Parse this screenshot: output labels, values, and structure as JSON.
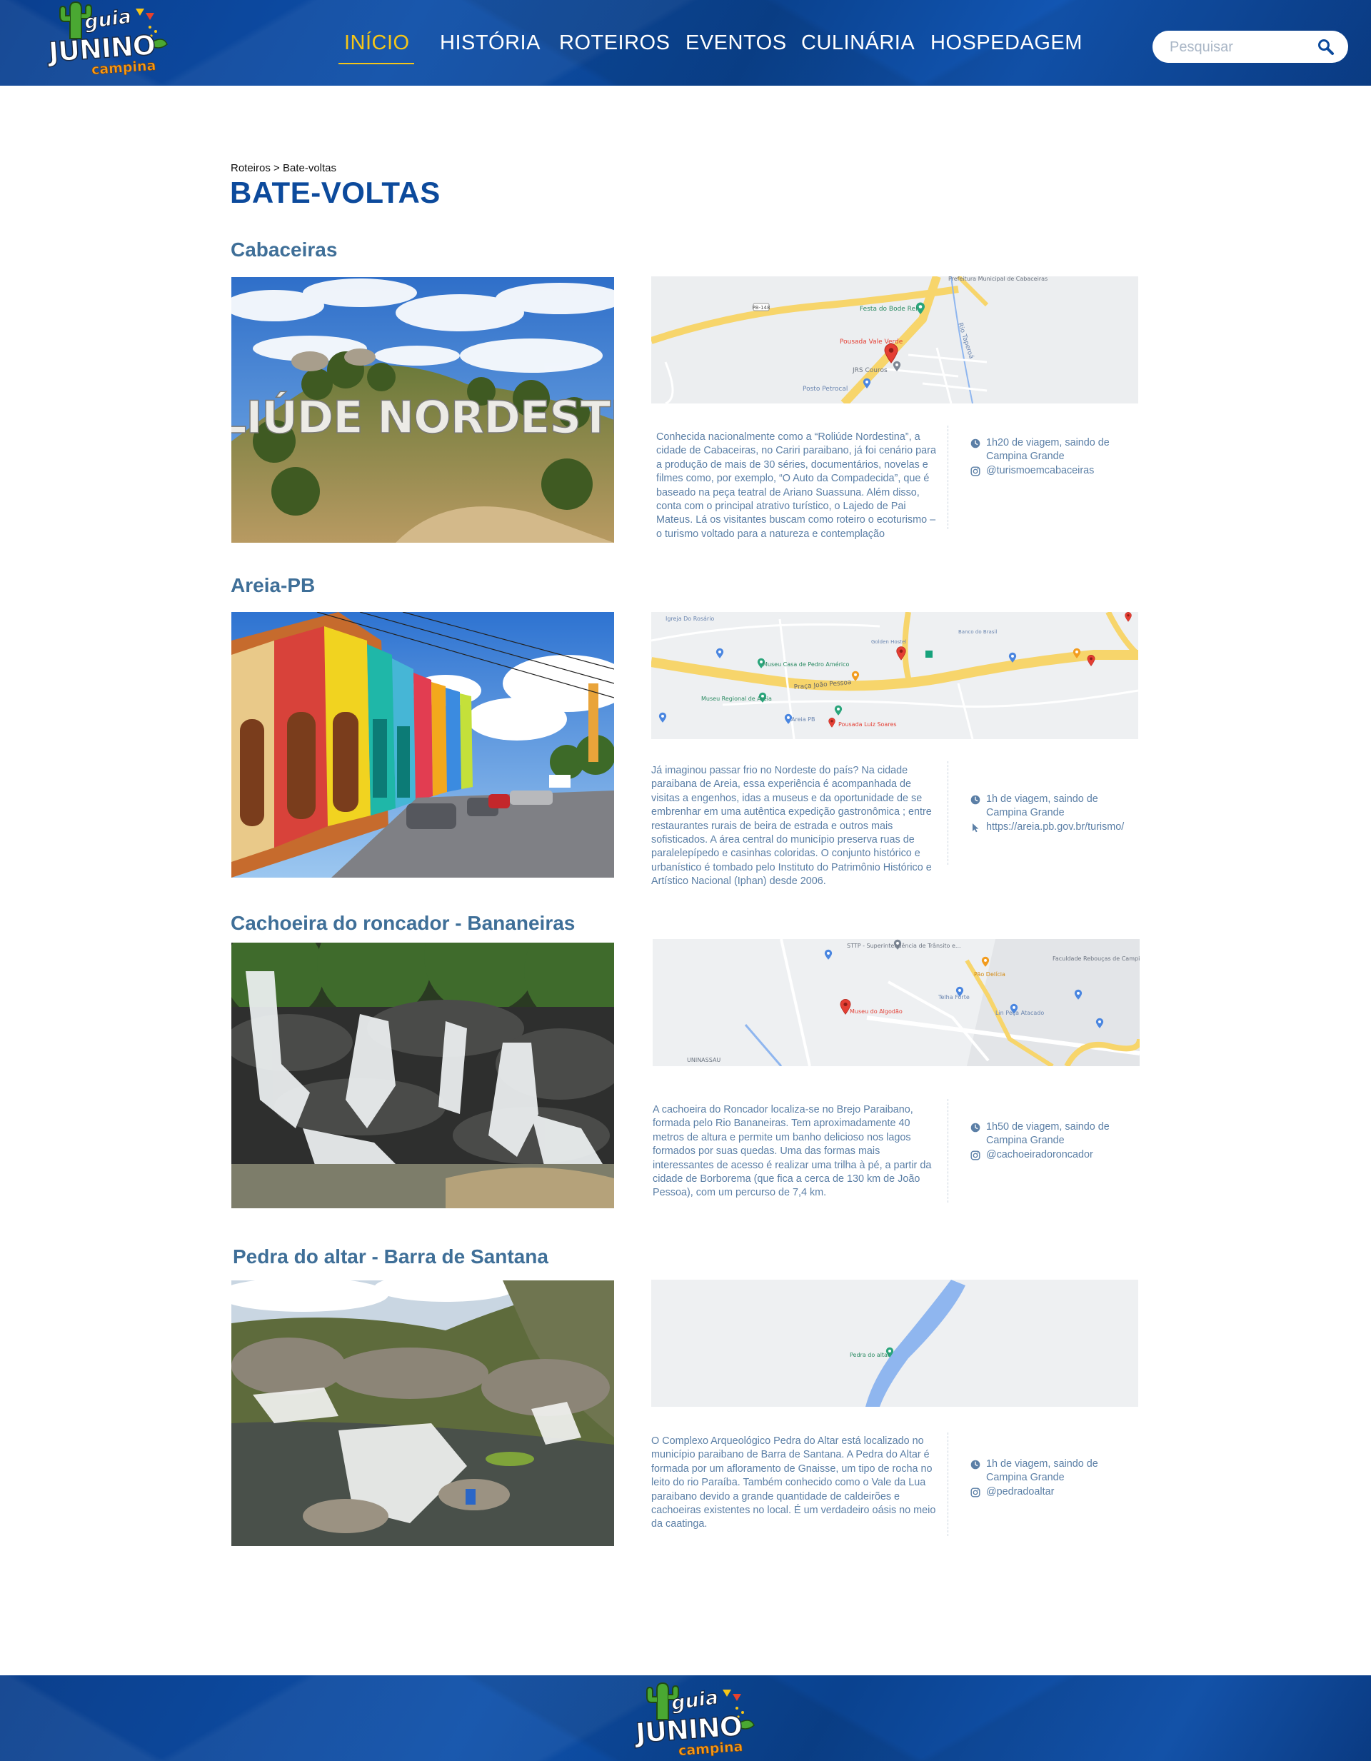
{
  "header": {
    "logo": {
      "line1": "guia",
      "line2": "JUNINO",
      "line3": "campina"
    },
    "nav": [
      {
        "label": "INÍCIO",
        "active": true
      },
      {
        "label": "HISTÓRIA",
        "active": false
      },
      {
        "label": "ROTEIROS",
        "active": false
      },
      {
        "label": "EVENTOS",
        "active": false
      },
      {
        "label": "CULINÁRIA",
        "active": false
      },
      {
        "label": "HOSPEDAGEM",
        "active": false
      }
    ],
    "search": {
      "placeholder": "Pesquisar",
      "value": ""
    }
  },
  "breadcrumb": {
    "parent": "Roteiros",
    "separator": " > ",
    "current": "Bate-voltas"
  },
  "page_title": "BATE-VOLTAS",
  "sections": [
    {
      "title": "Cabaceiras",
      "photo_sign": "RULIÚDE NORDESTINA",
      "map_labels": {
        "road1": "PB-148",
        "place1": "Festa do Bode Rei",
        "place2": "Pousada Vale Verde",
        "place3": "JRS Couros",
        "place4": "Posto Petrocal",
        "river": "Rio Taperoá",
        "place5": "Prefeitura Municipal de Cabaceiras"
      },
      "description": "Conhecida nacionalmente como a “Roliúde Nordestina”, a cidade de Cabaceiras, no Cariri paraibano, já foi cenário para a produção de mais de 30 séries, documentários, novelas e filmes como, por exemplo, “O Auto da Compadecida”, que é baseado na peça teatral de Ariano Suassuna. Além disso, conta com o principal atrativo turístico, o Lajedo de Pai Mateus. Lá os visitantes buscam como roteiro o ecoturismo – o turismo voltado para a natureza e contemplação",
      "travel": "1h20 de viagem, saindo de Campina Grande",
      "contact": "@turismoemcabaceiras",
      "contact_icon": "instagram-icon"
    },
    {
      "title": "Areia-PB",
      "map_labels": {
        "place1": "Igreja Do Rosário",
        "place2": "Museu Casa de Pedro Américo",
        "place3": "Museu Regional de Areia",
        "place4": "Areia PB",
        "place5": "Pousada Luiz Soares",
        "street": "Praça João Pessoa",
        "place6": "Banco do Brasil",
        "place7": "Golden Hostel"
      },
      "description": "Já imaginou passar frio no Nordeste do país? Na cidade paraibana de Areia, essa experiência é acompanhada de visitas a engenhos, idas a museus e da oportunidade de se embrenhar em uma autêntica expedição gastronômica ; entre restaurantes rurais de beira de estrada e outros mais sofisticados. A área central do município preserva ruas de paralelepípedo e casinhas coloridas. O conjunto histórico e urbanístico é tombado pelo Instituto do Patrimônio Histórico e Artístico Nacional (Iphan) desde 2006.",
      "travel": "1h de viagem, saindo de Campina Grande",
      "contact": "https://areia.pb.gov.br/turismo/",
      "contact_icon": "cursor-icon"
    },
    {
      "title": "Cachoeira do roncador - Bananeiras",
      "map_labels": {
        "place1": "STTP - Superintendência de Trânsito e...",
        "place2": "Pão Delícia",
        "place3": "Museu do Algodão",
        "place4": "Telha Forte",
        "place5": "Lin Peça Atacado",
        "place6": "UNINASSAU",
        "place7": "Faculdade Rebouças de Campina Grande"
      },
      "description": "A cachoeira do Roncador localiza-se no Brejo Paraibano, formada pelo Rio Bananeiras. Tem aproximadamente 40 metros de altura e permite um banho delicioso nos lagos formados por suas quedas. Uma das formas mais interessantes de acesso é realizar uma trilha à pé, a partir da cidade de Borborema (que fica a cerca de 130 km de João Pessoa), com um percurso de 7,4 km.",
      "travel": "1h50 de viagem, saindo de Campina Grande",
      "contact": "@cachoeiradoroncador",
      "contact_icon": "instagram-icon"
    },
    {
      "title": "Pedra do altar - Barra de Santana",
      "map_labels": {
        "place1": "Pedra do altar"
      },
      "description": "O Complexo Arqueológico Pedra do Altar está localizado no município paraibano de Barra de Santana. A Pedra do Altar é formada por um afloramento de Gnaisse, um tipo de rocha no leito do rio Paraíba. Também conhecido como o Vale da Lua paraibano devido a grande quantidade de caldeirões e cachoeiras existentes no local. É um verdadeiro oásis no meio da caatinga.",
      "travel": "1h de viagem, saindo de Campina Grande",
      "contact": "@pedradoaltar",
      "contact_icon": "instagram-icon"
    }
  ],
  "colors": {
    "brand_blue": "#0c4a9c",
    "accent_yellow": "#f5c518",
    "text_blue": "#5b7fa6",
    "title_blue": "#3f6f98"
  }
}
